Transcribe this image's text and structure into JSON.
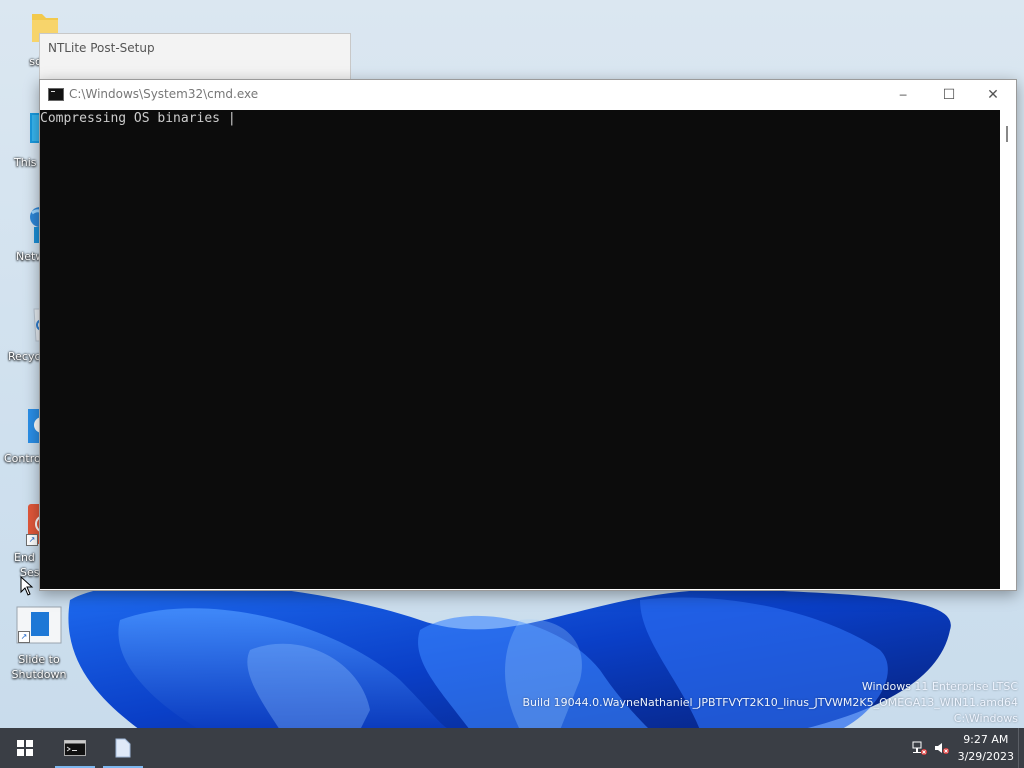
{
  "desktop": {
    "icons": [
      {
        "label": "sda",
        "icon": "folder-icon"
      },
      {
        "label": "This",
        "icon": "monitor-icon"
      },
      {
        "label": "Netw",
        "icon": "network-icon"
      },
      {
        "label": "Recyc",
        "icon": "recycle-bin-icon"
      },
      {
        "label": "Contro",
        "icon": "control-panel-icon"
      },
      {
        "label": "End",
        "label2": "Sess",
        "icon": "power-icon"
      },
      {
        "label": "Slide to",
        "label2": "Shutdown",
        "icon": "slide-shutdown-icon"
      }
    ]
  },
  "ntlite_window": {
    "title": "NTLite Post-Setup"
  },
  "cmd_window": {
    "title": "C:\\Windows\\System32\\cmd.exe",
    "console_text": "Compressing OS binaries |",
    "minimize_symbol": "─",
    "maximize_symbol": "☐",
    "close_symbol": "✕",
    "console_bg": "#0c0c0c",
    "console_fg": "#cccccc"
  },
  "watermark": {
    "line1": "Windows 11 Enterprise LTSC",
    "line2": "Build 19044.0.WayneNathaniel_JPBTFVYT2K10_linus_JTVWM2K5_OMEGA13_WIN11.amd64",
    "line3": "C:\\Windows"
  },
  "taskbar": {
    "clock_time": "9:27 AM",
    "clock_date": "3/29/2023",
    "background": "#3a3e45",
    "accent": "#7db7ef"
  }
}
